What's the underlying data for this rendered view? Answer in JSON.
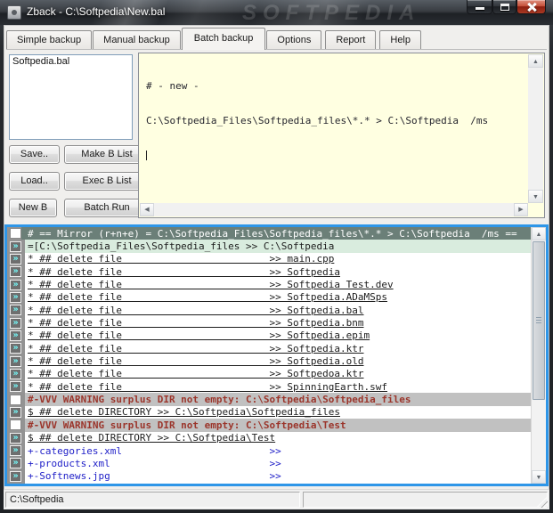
{
  "window": {
    "title": "Zback - C:\\Softpedia\\New.bal",
    "watermark": "SOFTPEDIA"
  },
  "tabs": {
    "active": "Batch backup",
    "items": [
      "Simple backup",
      "Manual backup",
      "Batch backup",
      "Options",
      "Report",
      "Help"
    ]
  },
  "batch_list": {
    "items": [
      "Softpedia.bal"
    ]
  },
  "buttons": {
    "save": "Save..",
    "make": "Make B List",
    "load": "Load..",
    "exec": "Exec B List",
    "new": "New B",
    "run": "Batch Run"
  },
  "memo": {
    "lines": [
      "# - new -",
      "C:\\Softpedia_Files\\Softpedia_files\\*.* > C:\\Softpedia  /ms"
    ]
  },
  "icons": {
    "run_chevrons": "»"
  },
  "console": {
    "rows": [
      {
        "style": "header",
        "icon": "blank",
        "text": "# == Mirror (r+n+e) = C:\\Softpedia_Files\\Softpedia_files\\*.* > C:\\Softpedia  /ms =="
      },
      {
        "style": "mirror",
        "icon": "run",
        "text": "=[C:\\Softpedia_Files\\Softpedia_files >> C:\\Softpedia"
      },
      {
        "style": "del",
        "icon": "run",
        "text": "* ## delete file",
        "dest": ">> main.cpp"
      },
      {
        "style": "del",
        "icon": "run",
        "text": "* ## delete file",
        "dest": ">> Softpedia"
      },
      {
        "style": "del",
        "icon": "run",
        "text": "* ## delete file",
        "dest": ">> Softpedia Test.dev"
      },
      {
        "style": "del",
        "icon": "run",
        "text": "* ## delete file",
        "dest": ">> Softpedia.ADaMSps"
      },
      {
        "style": "del",
        "icon": "run",
        "text": "* ## delete file",
        "dest": ">> Softpedia.bal"
      },
      {
        "style": "del",
        "icon": "run",
        "text": "* ## delete file",
        "dest": ">> Softpedia.bnm"
      },
      {
        "style": "del",
        "icon": "run",
        "text": "* ## delete file",
        "dest": ">> Softpedia.epim"
      },
      {
        "style": "del",
        "icon": "run",
        "text": "* ## delete file",
        "dest": ">> Softpedia.ktr"
      },
      {
        "style": "del",
        "icon": "run",
        "text": "* ## delete file",
        "dest": ">> Softpedia.old"
      },
      {
        "style": "del",
        "icon": "run",
        "text": "* ## delete file",
        "dest": ">> Softpedoa.ktr"
      },
      {
        "style": "del",
        "icon": "run",
        "text": "* ## delete file",
        "dest": ">> SpinningEarth.swf"
      },
      {
        "style": "warn",
        "icon": "blank",
        "text": "#-VVV WARNING surplus DIR not empty: C:\\Softpedia\\Softpedia_files"
      },
      {
        "style": "deldir",
        "icon": "run",
        "text": "$ ## delete DIRECTORY >> C:\\Softpedia\\Softpedia_files"
      },
      {
        "style": "warn",
        "icon": "blank",
        "text": "#-VVV WARNING surplus DIR not empty: C:\\Softpedia\\Test"
      },
      {
        "style": "deldir",
        "icon": "run",
        "text": "$ ## delete DIRECTORY >> C:\\Softpedia\\Test"
      },
      {
        "style": "blue",
        "icon": "run",
        "text": "+-categories.xml",
        "dest": ">>"
      },
      {
        "style": "blue",
        "icon": "run",
        "text": "+-products.xml",
        "dest": ">>"
      },
      {
        "style": "blue",
        "icon": "run",
        "text": "+-Softnews.jpg",
        "dest": ">>"
      }
    ]
  },
  "statusbar": {
    "path": "C:\\Softpedia"
  }
}
